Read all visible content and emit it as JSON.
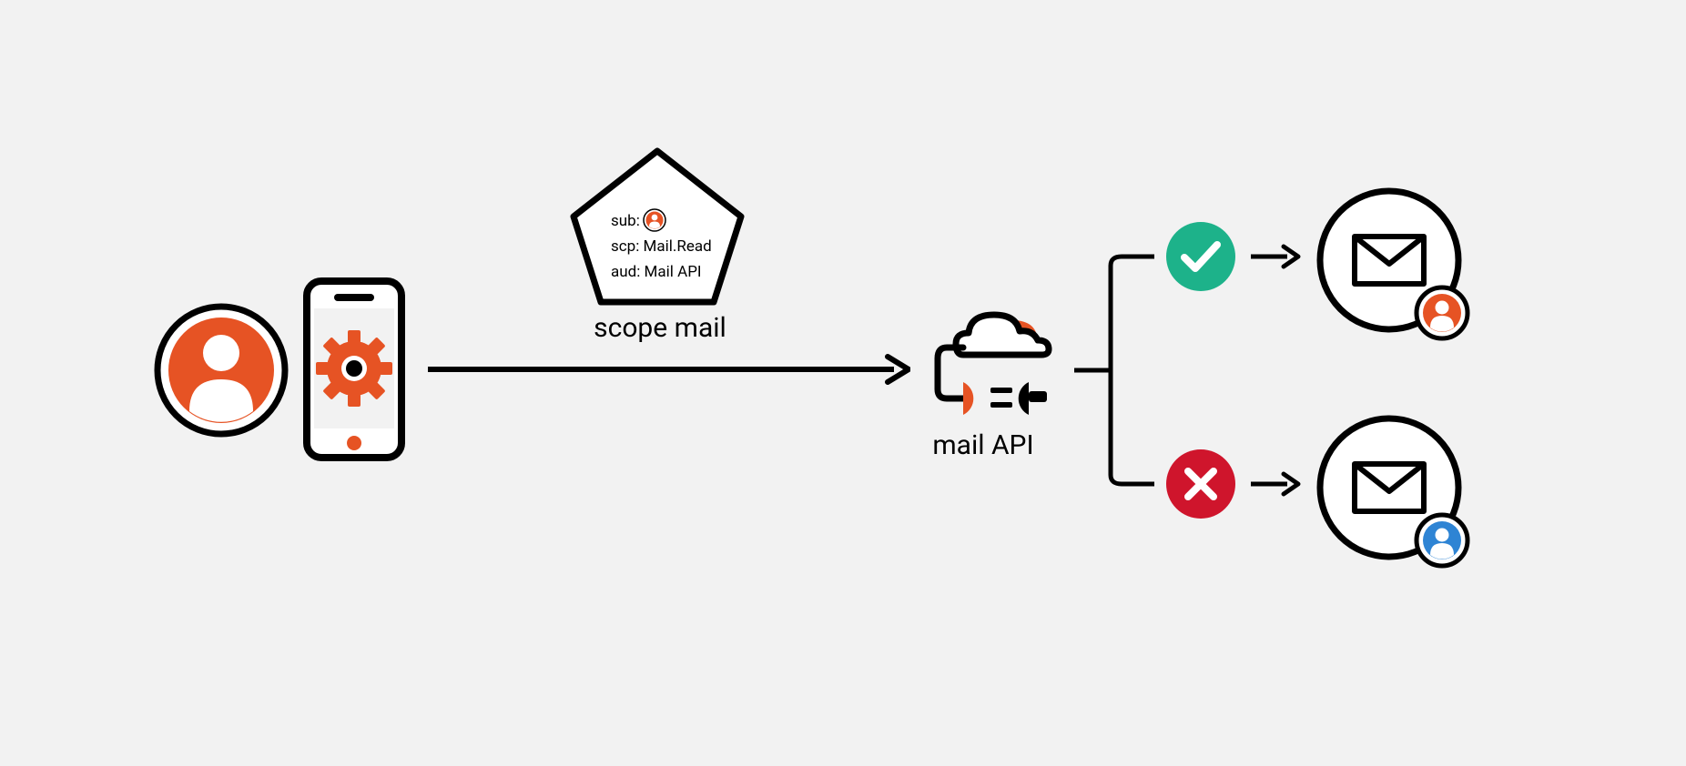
{
  "token": {
    "sub_label": "sub:",
    "scp_line": "scp: Mail.Read",
    "aud_line": "aud: Mail API"
  },
  "labels": {
    "scope": "scope mail",
    "api": "mail API"
  },
  "colors": {
    "orange": "#e65324",
    "green": "#1db28a",
    "red": "#cf152c",
    "blue": "#2e84d4",
    "black": "#000000",
    "bg": "#f2f2f2",
    "white": "#ffffff"
  }
}
